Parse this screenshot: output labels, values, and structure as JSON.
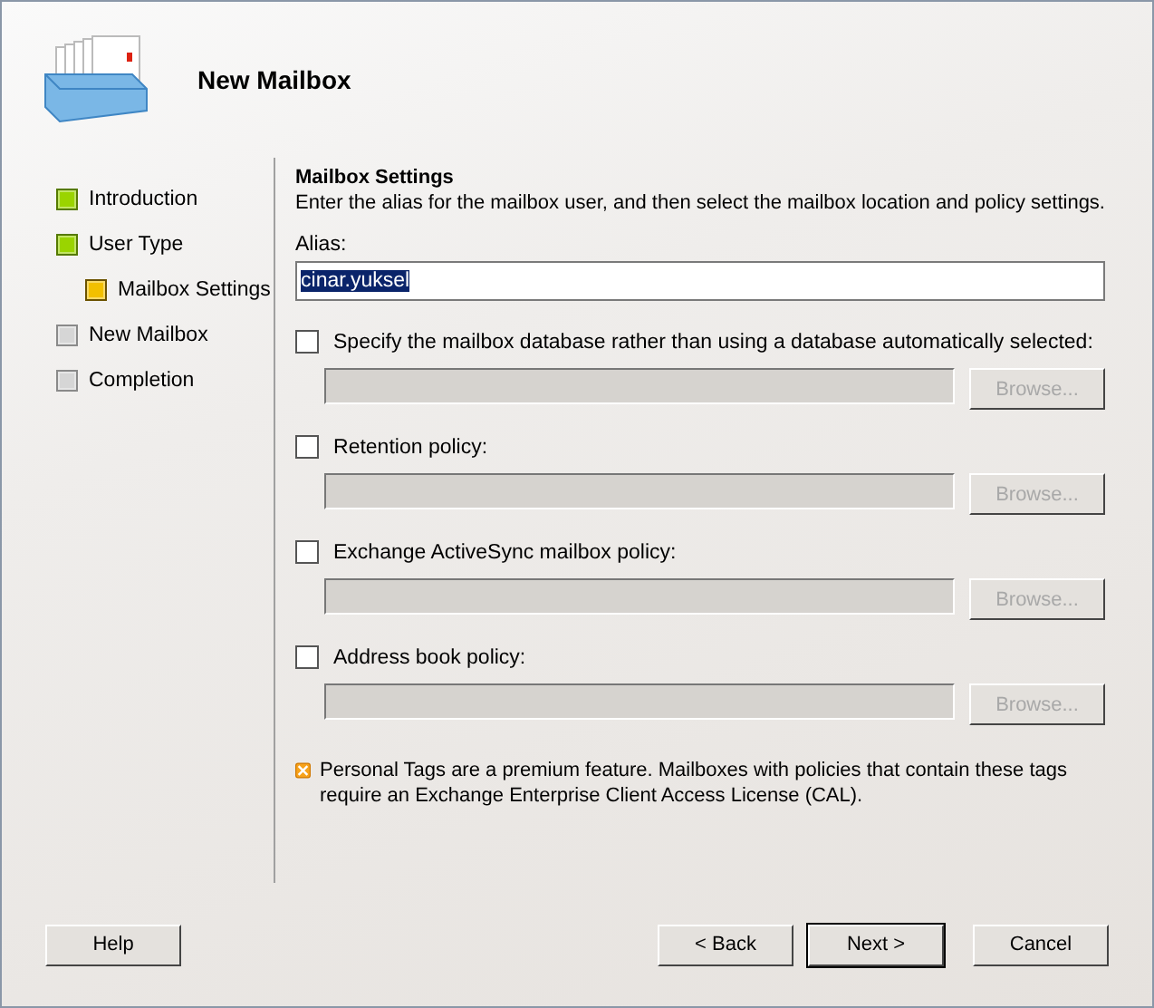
{
  "header": {
    "title": "New Mailbox"
  },
  "steps": [
    {
      "label": "Introduction",
      "kind": "done"
    },
    {
      "label": "User Type",
      "kind": "done",
      "children": [
        {
          "label": "Mailbox Settings",
          "kind": "current"
        }
      ]
    },
    {
      "label": "New Mailbox",
      "kind": "pending"
    },
    {
      "label": "Completion",
      "kind": "pending"
    }
  ],
  "page": {
    "heading": "Mailbox Settings",
    "description": "Enter the alias for the mailbox user, and then select the mailbox location and policy settings.",
    "alias": {
      "label": "Alias:",
      "value": "cinar.yuksel",
      "selected_text": true
    }
  },
  "options": [
    {
      "label": "Specify the mailbox database rather than using a database automatically selected:",
      "checked": false,
      "browse": "Browse...",
      "disabled": true
    },
    {
      "label": "Retention policy:",
      "checked": false,
      "browse": "Browse...",
      "disabled": true
    },
    {
      "label": "Exchange ActiveSync mailbox policy:",
      "checked": false,
      "browse": "Browse...",
      "disabled": true
    },
    {
      "label": "Address book policy:",
      "checked": false,
      "browse": "Browse...",
      "disabled": true
    }
  ],
  "notice": "Personal Tags are a premium feature. Mailboxes with policies that contain these tags require an Exchange Enterprise Client Access License (CAL).",
  "buttons": {
    "help": "Help",
    "back": "< Back",
    "next": "Next >",
    "cancel": "Cancel"
  }
}
